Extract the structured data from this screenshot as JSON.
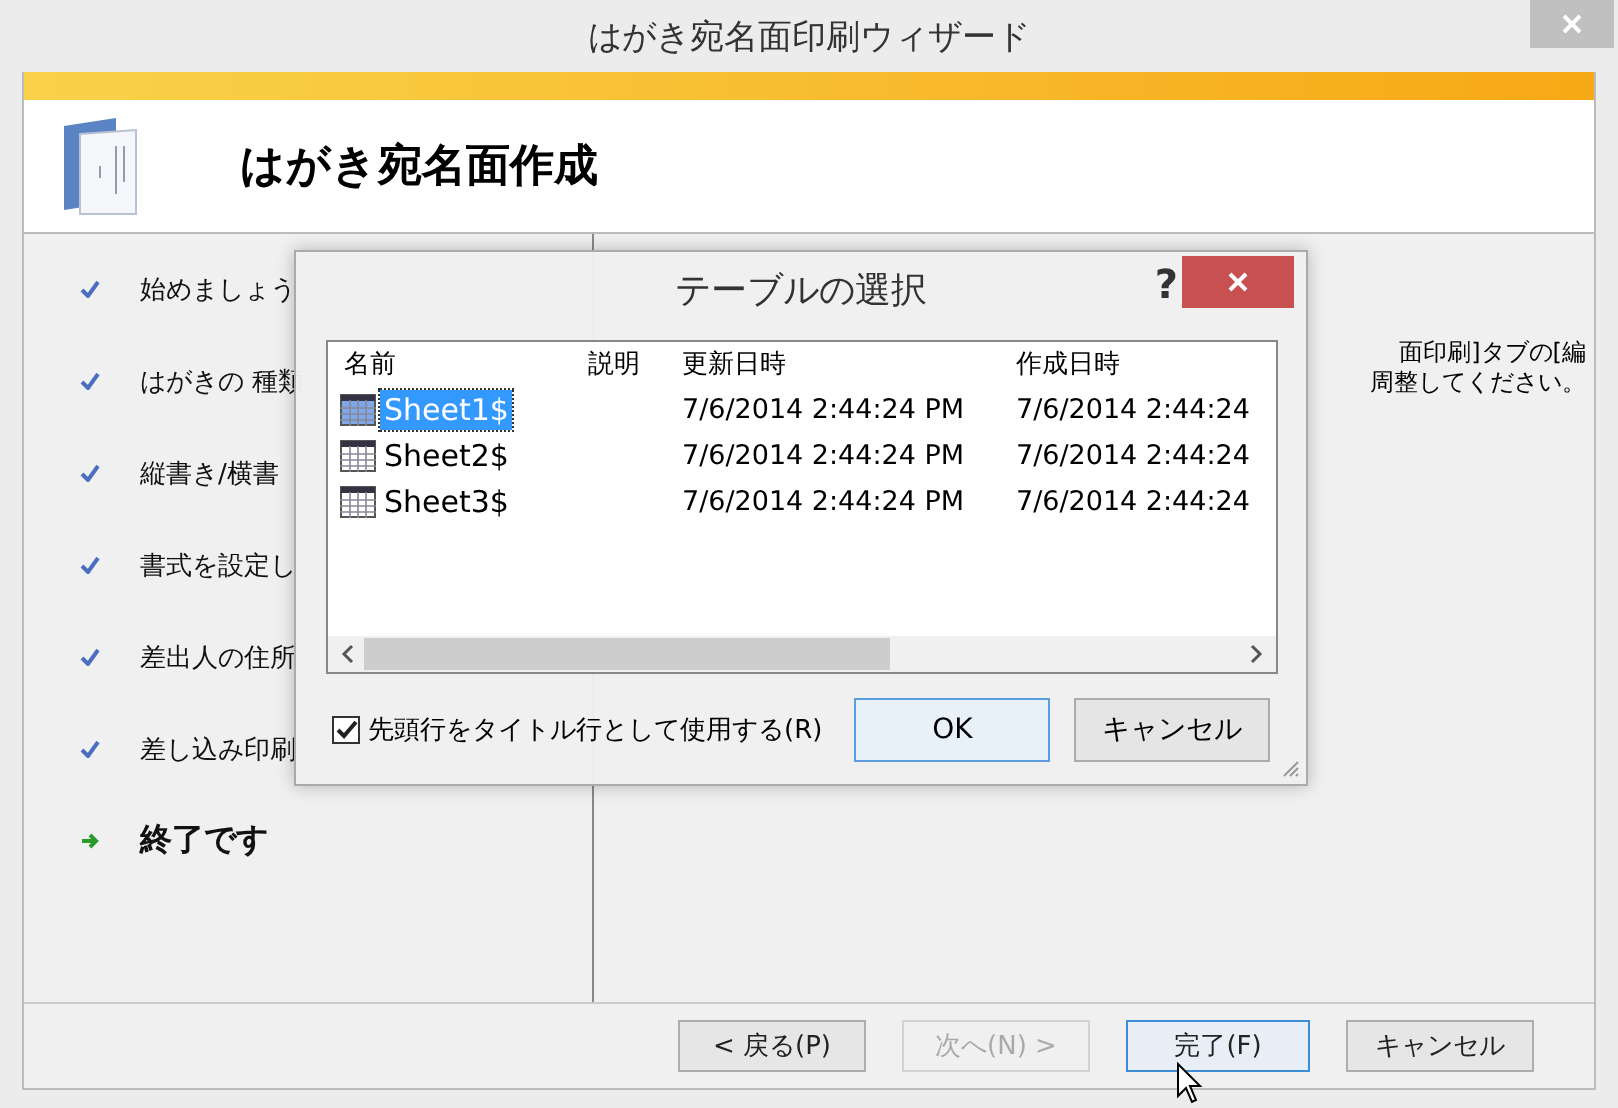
{
  "window": {
    "title": "はがき宛名面印刷ウィザード"
  },
  "header": {
    "title": "はがき宛名面作成"
  },
  "steps": [
    {
      "label": "始めましょう",
      "kind": "done"
    },
    {
      "label": "はがきの 種類",
      "kind": "done"
    },
    {
      "label": "縦書き/横書",
      "kind": "done"
    },
    {
      "label": "書式を設定し",
      "kind": "done"
    },
    {
      "label": "差出人の住所",
      "kind": "done"
    },
    {
      "label": "差し込み印刷",
      "kind": "done"
    },
    {
      "label": "終了です",
      "kind": "current"
    }
  ],
  "content": {
    "lines": [
      "面印刷]タブの[編",
      "周整してください。"
    ]
  },
  "buttons": [
    {
      "label": "< 戻る(P)",
      "disabled": false,
      "focused": false
    },
    {
      "label": "次へ(N) >",
      "disabled": true,
      "focused": false
    },
    {
      "label": "完了(F)",
      "disabled": false,
      "focused": true
    },
    {
      "label": "キャンセル",
      "disabled": false,
      "focused": false
    }
  ],
  "dialog": {
    "title": "テーブルの選択",
    "help": "?",
    "columns": [
      "名前",
      "説明",
      "更新日時",
      "作成日時"
    ],
    "rows": [
      {
        "name": "Sheet1$",
        "description": "",
        "modified": "7/6/2014 2:44:24 PM",
        "created": "7/6/2014 2:44:24",
        "selected": true
      },
      {
        "name": "Sheet2$",
        "description": "",
        "modified": "7/6/2014 2:44:24 PM",
        "created": "7/6/2014 2:44:24",
        "selected": false
      },
      {
        "name": "Sheet3$",
        "description": "",
        "modified": "7/6/2014 2:44:24 PM",
        "created": "7/6/2014 2:44:24",
        "selected": false
      }
    ],
    "checkbox": {
      "label": "先頭行をタイトル行として使用する(R)",
      "checked": true
    },
    "buttons": [
      {
        "label": "OK",
        "focused": true
      },
      {
        "label": "キャンセル",
        "focused": false
      }
    ]
  }
}
